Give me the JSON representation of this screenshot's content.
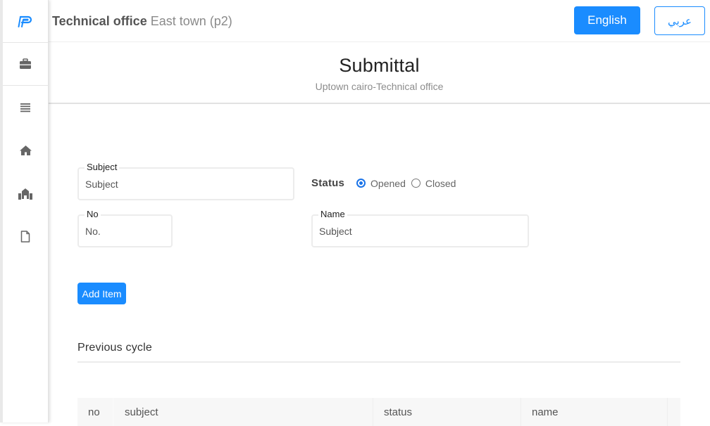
{
  "sidebar": {
    "logo_icon": "brand-p-logo",
    "items": [
      {
        "icon": "briefcase-icon"
      },
      {
        "icon": "list-icon"
      },
      {
        "icon": "home-icon"
      },
      {
        "icon": "buildings-icon"
      },
      {
        "icon": "document-icon"
      }
    ]
  },
  "topbar": {
    "title_strong": "Technical office",
    "title_light": "East town (p2)",
    "english_label": "English",
    "arabic_label": "عربي"
  },
  "header": {
    "title": "Submittal",
    "subtitle": "Uptown cairo-Technical office"
  },
  "form": {
    "subject": {
      "label": "Subject",
      "placeholder": "Subject"
    },
    "no": {
      "label": "No",
      "placeholder": "No."
    },
    "name": {
      "label": "Name",
      "placeholder": "Subject"
    },
    "status": {
      "label": "Status",
      "options": [
        "Opened",
        "Closed"
      ],
      "selected": "Opened"
    },
    "add_button": "Add Item"
  },
  "previous_cycle": {
    "title": "Previous cycle",
    "columns": [
      "no",
      "subject",
      "status",
      "name"
    ]
  },
  "colors": {
    "accent": "#1a8cff",
    "radio": "#1a73e8"
  }
}
